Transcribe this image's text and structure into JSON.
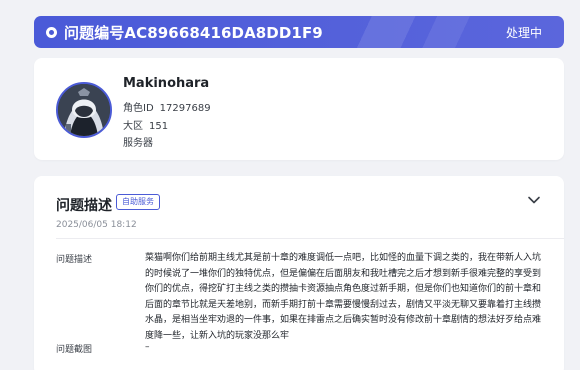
{
  "ticket": {
    "title": "问题编号AC89668416DA8DD1F9",
    "status": "处理中"
  },
  "profile": {
    "name": "Makinohara",
    "role_id_label": "角色ID",
    "role_id_value": "17297689",
    "region_label": "大区",
    "region_value": "151",
    "server_label": "服务器",
    "server_value": ""
  },
  "issue": {
    "section_title": "问题描述",
    "tag": "自助服务",
    "date": "2025/06/05 18:12",
    "description_label": "问题描述",
    "description": "菜猫啊你们给前期主线尤其是前十章的难度调低一点吧，比如怪的血量下调之类的，我在带新人入坑的时候说了一堆你们的独特优点，但是偏偏在后面朋友和我吐槽完之后才想到新手很难完整的享受到你们的优点，得挖矿打主线之类的攒抽卡资源抽点角色度过新手期，但是你们也知道你们的前十章和后面的章节比就是天差地别，而新手期打前十章需要慢慢刮过去，剧情又平淡无聊又要靠着打主线攒水晶，是相当坐牢劝退的一件事，如果在排雷点之后确实暂时没有修改前十章剧情的想法好歹给点难度降一些，让新入坑的玩家没那么牢",
    "screenshot_label": "问题截图",
    "screenshot_value": "–"
  },
  "icons": {
    "header": "status-dot-icon",
    "collapse": "chevron-down-icon",
    "avatar": "player-avatar"
  },
  "colors": {
    "accent": "#4b5bd6",
    "background": "#f1f2f6",
    "card": "#ffffff"
  }
}
